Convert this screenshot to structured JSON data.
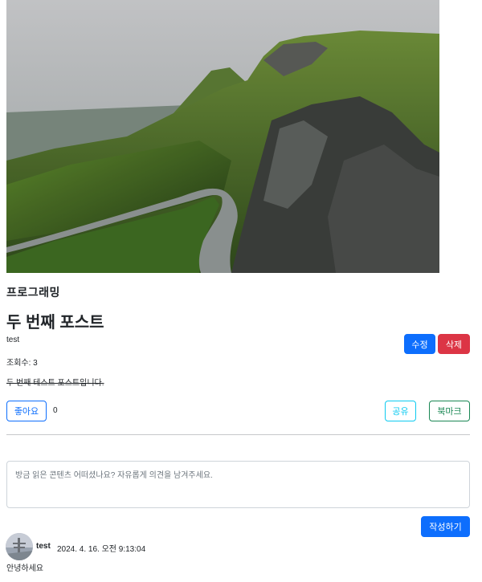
{
  "post": {
    "category": "프로그래밍",
    "title": "두 번째 포스트",
    "author": "test",
    "views": "조회수: 3",
    "content": "두 번째 테스트 포스트입니다."
  },
  "actions": {
    "edit_label": "수정",
    "delete_label": "삭제",
    "like_label": "좋아요",
    "like_count": "0",
    "share_label": "공유",
    "bookmark_label": "북마크"
  },
  "comment_form": {
    "placeholder": "방금 읽은 콘텐츠 어떠셨나요? 자유롭게 의견을 남겨주세요.",
    "submit_label": "작성하기"
  },
  "comments": [
    {
      "author": "test",
      "date": "2024. 4. 16. 오전 9:13:04",
      "text": "안녕하세요"
    }
  ],
  "colors": {
    "primary": "#0d6efd",
    "danger": "#dc3545",
    "info": "#0dcaf0",
    "success": "#198754"
  }
}
